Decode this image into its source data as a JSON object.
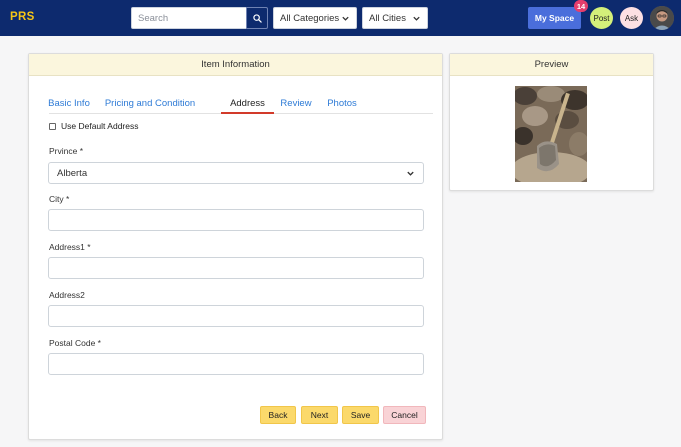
{
  "header": {
    "brand": "PRS",
    "search_placeholder": "Search",
    "category_select": "All Categories",
    "city_select": "All Cities",
    "myspace_label": "My Space",
    "myspace_badge": "14",
    "post_label": "Post",
    "ask_label": "Ask"
  },
  "item_card": {
    "title": "Item Information",
    "tabs": [
      {
        "label": "Basic Info"
      },
      {
        "label": "Pricing and Condition"
      },
      {
        "label": "Address"
      },
      {
        "label": "Review"
      },
      {
        "label": "Photos"
      }
    ],
    "active_tab": "Address",
    "default_address_label": "Use Default Address",
    "default_address_checked": false,
    "fields": {
      "province_label": "Prvince *",
      "province_value": "Alberta",
      "city_label": "City *",
      "city_value": "",
      "address1_label": "Address1 *",
      "address1_value": "",
      "address2_label": "Address2",
      "address2_value": "",
      "postal_label": "Postal Code *",
      "postal_value": ""
    },
    "buttons": {
      "back": "Back",
      "next": "Next",
      "save": "Save",
      "cancel": "Cancel"
    }
  },
  "preview_card": {
    "title": "Preview"
  },
  "colors": {
    "topbar": "#0d2a6e",
    "brand": "#f6c516",
    "myspace": "#4a6edb",
    "badge": "#e63d6c",
    "card_header": "#fbf6dd",
    "tab_active_underline": "#d23a2a",
    "link": "#2e7bd6",
    "button_yellow": "#fbd96b",
    "button_pink": "#f9d3d6"
  },
  "icons": [
    "search-icon",
    "chevron-down-icon",
    "user-avatar"
  ]
}
